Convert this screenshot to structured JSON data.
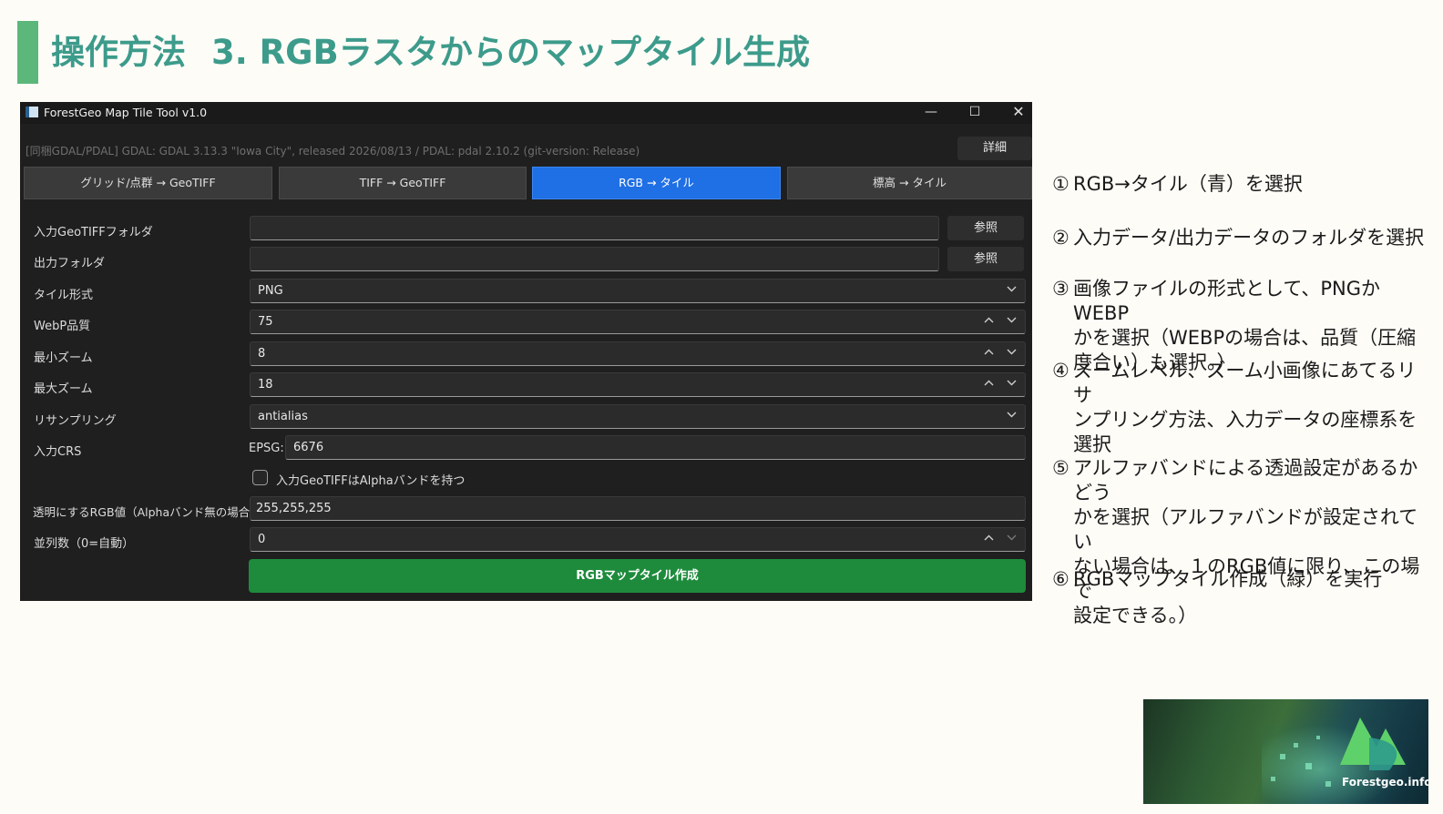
{
  "slide": {
    "title_main": "操作方法",
    "title_sub": "3. RGBラスタからのマップタイル生成"
  },
  "window": {
    "title": "ForestGeo Map Tile Tool v1.0",
    "controls": {
      "minimize": "—",
      "maximize": "☐",
      "close": "✕"
    },
    "info_text": "[同梱GDAL/PDAL]  GDAL: GDAL 3.13.3 \"Iowa City\", released 2026/08/13  /  PDAL: pdal 2.10.2 (git-version: Release)",
    "detail_button": "詳細",
    "tabs": [
      {
        "label": "グリッド/点群 → GeoTIFF",
        "active": false
      },
      {
        "label": "TIFF → GeoTIFF",
        "active": false
      },
      {
        "label": "RGB → タイル",
        "active": true
      },
      {
        "label": "標高 → タイル",
        "active": false
      }
    ],
    "form": {
      "input_folder": {
        "label": "入力GeoTIFFフォルダ",
        "value": "",
        "button": "参照"
      },
      "output_folder": {
        "label": "出力フォルダ",
        "value": "",
        "button": "参照"
      },
      "tile_format": {
        "label": "タイル形式",
        "value": "PNG"
      },
      "webp_quality": {
        "label": "WebP品質",
        "value": "75"
      },
      "min_zoom": {
        "label": "最小ズーム",
        "value": "8"
      },
      "max_zoom": {
        "label": "最大ズーム",
        "value": "18"
      },
      "resampling": {
        "label": "リサンプリング",
        "value": "antialias"
      },
      "input_crs": {
        "label": "入力CRS",
        "prefix": "EPSG:",
        "value": "6676"
      },
      "alpha_checkbox": {
        "label": "入力GeoTIFFはAlphaバンドを持つ",
        "checked": false
      },
      "transparent_rgb": {
        "label": "透明にするRGB値（Alphaバンド無の場合）",
        "value": "255,255,255"
      },
      "parallel": {
        "label": "並列数（0=自動）",
        "value": "0"
      }
    },
    "run_button": "RGBマップタイル作成"
  },
  "steps": [
    {
      "num": "①",
      "lines": [
        "RGB→タイル（青）を選択"
      ]
    },
    {
      "num": "②",
      "lines": [
        "入力データ/出力データのフォルダを選択"
      ]
    },
    {
      "num": "③",
      "lines": [
        "画像ファイルの形式として、PNGかWEBP",
        "かを選択（WEBPの場合は、品質（圧縮",
        "度合い）も選択。）"
      ]
    },
    {
      "num": "④",
      "lines": [
        "ズームレベル、ズーム小画像にあてるリサ",
        "ンプリング方法、入力データの座標系を",
        "選択"
      ]
    },
    {
      "num": "⑤",
      "lines": [
        "アルファバンドによる透過設定があるかどう",
        "かを選択（アルファバンドが設定されてい",
        "ない場合は、１のRGB値に限り、この場で",
        "設定できる。）"
      ]
    },
    {
      "num": "⑥",
      "lines": [
        "RGBマップタイル作成（緑）を実行"
      ]
    }
  ],
  "logo": {
    "text": "Forestgeo.info"
  },
  "colors": {
    "title": "#3d9b8b",
    "accent_bar": "#5cb87a",
    "active_tab": "#1f6fe5",
    "run_button": "#1e8b3c"
  }
}
